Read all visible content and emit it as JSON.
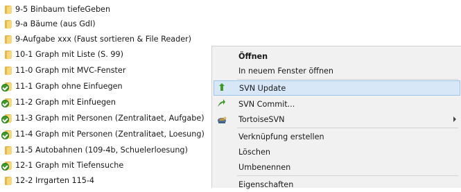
{
  "files": [
    {
      "label": "9-5 Binbaum tiefeGeben",
      "svn": false
    },
    {
      "label": "9-a Bäume (aus GdI)",
      "svn": false
    },
    {
      "label": "9-Aufgabe xxx (Faust sortieren & File Reader)",
      "svn": false
    },
    {
      "label": "10-1 Graph mit Liste (S. 99)",
      "svn": false
    },
    {
      "label": "11-0 Graph mit MVC-Fenster",
      "svn": false
    },
    {
      "label": "11-1 Graph ohne Einfuegen",
      "svn": true
    },
    {
      "label": "11-2 Graph mit Einfuegen",
      "svn": true
    },
    {
      "label": "11-3 Graph mit Personen (Zentralitaet, Aufgabe)",
      "svn": true
    },
    {
      "label": "11-4 Graph mit Personen (Zentralitaet, Loesung)",
      "svn": true
    },
    {
      "label": "11-5  Autobahnen (109-4b, Schuelerloesung)",
      "svn": false
    },
    {
      "label": "12-1 Graph mit Tiefensuche",
      "svn": true
    },
    {
      "label": "12-2 Irrgarten 115-4",
      "svn": false
    }
  ],
  "context_menu": {
    "open": "Öffnen",
    "open_new_window": "In neuem Fenster öffnen",
    "svn_update": "SVN Update",
    "svn_commit": "SVN Commit...",
    "tortoise_svn": "TortoiseSVN",
    "create_shortcut": "Verknüpfung erstellen",
    "delete": "Löschen",
    "rename": "Umbenennen",
    "properties": "Eigenschaften"
  },
  "icons": {
    "folder": "folder-icon",
    "svn_status": "svn-normal-overlay-icon",
    "svn_update": "svn-update-icon",
    "svn_commit": "svn-commit-icon",
    "tortoise_svn": "tortoisesvn-icon",
    "submenu": "chevron-right-icon"
  },
  "colors": {
    "menu_background": "#f1f1f1",
    "menu_highlight": "#d7e7f8",
    "menu_highlight_border": "#9ec4ea",
    "svn_green": "#3f9a2b",
    "folder_yellow": "#f6d77a"
  }
}
